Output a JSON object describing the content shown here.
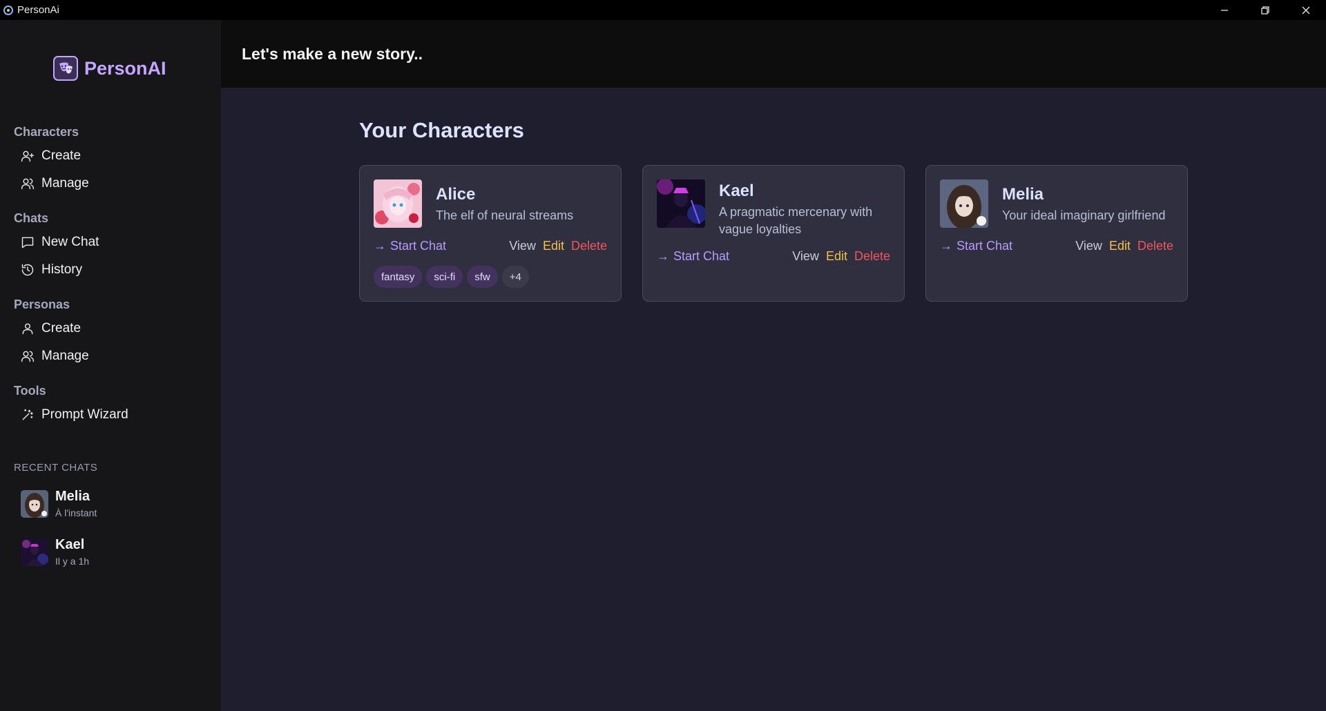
{
  "window": {
    "title": "PersonAi",
    "controls": [
      "minimize-icon",
      "restore-icon",
      "close-icon"
    ]
  },
  "sidebar": {
    "logo": "PersonAI",
    "sections": [
      {
        "title": "Characters",
        "items": [
          {
            "label": "Create",
            "icon": "user-plus-icon"
          },
          {
            "label": "Manage",
            "icon": "users-icon"
          }
        ]
      },
      {
        "title": "Chats",
        "items": [
          {
            "label": "New Chat",
            "icon": "message-square-icon"
          },
          {
            "label": "History",
            "icon": "history-icon"
          }
        ]
      },
      {
        "title": "Personas",
        "items": [
          {
            "label": "Create",
            "icon": "user-icon"
          },
          {
            "label": "Manage",
            "icon": "users-icon"
          }
        ]
      },
      {
        "title": "Tools",
        "items": [
          {
            "label": "Prompt Wizard",
            "icon": "wand-icon"
          }
        ]
      }
    ],
    "recent_title": "RECENT CHATS",
    "recent": [
      {
        "name": "Melia",
        "time": "À l'instant"
      },
      {
        "name": "Kael",
        "time": "Il y a 1h"
      }
    ]
  },
  "header": {
    "title": "Let's make a new story.."
  },
  "main": {
    "title": "Your Characters",
    "cards": [
      {
        "name": "Alice",
        "desc": "The elf of neural streams",
        "start": "Start Chat",
        "view": "View",
        "edit": "Edit",
        "delete": "Delete",
        "tags": [
          "fantasy",
          "sci-fi",
          "sfw"
        ],
        "more": "+4"
      },
      {
        "name": "Kael",
        "desc": "A pragmatic mercenary with vague loyalties",
        "start": "Start Chat",
        "view": "View",
        "edit": "Edit",
        "delete": "Delete"
      },
      {
        "name": "Melia",
        "desc": "Your ideal imaginary girlfriend",
        "start": "Start Chat",
        "view": "View",
        "edit": "Edit",
        "delete": "Delete"
      }
    ]
  },
  "colors": {
    "accent": "#c4a6ff",
    "edit": "#f3c04a",
    "delete": "#f0565f",
    "background": "#1e1e2e",
    "sidebar": "#161618"
  }
}
